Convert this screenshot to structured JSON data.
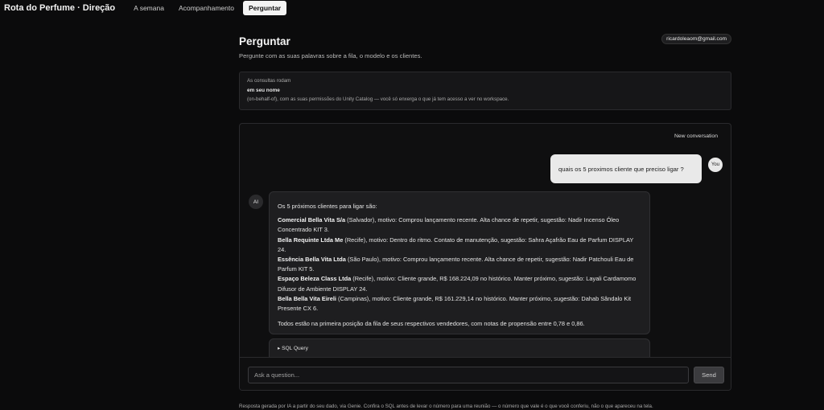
{
  "app": {
    "title": "Rota do Perfume · Direção",
    "nav": [
      {
        "label": "A semana",
        "active": false
      },
      {
        "label": "Acompanhamento",
        "active": false
      },
      {
        "label": "Perguntar",
        "active": true
      }
    ]
  },
  "header": {
    "title": "Perguntar",
    "subtitle": "Pergunte com as suas palavras sobre a fila, o modelo e os clientes.",
    "user_email": "ricardoleaom@gmail.com"
  },
  "notice": {
    "line1": "As consultas rodam",
    "line2": "em seu nome",
    "line3": "(on-behalf-of), com as suas permissões do Unity Catalog — você só enxerga o que já tem acesso a ver no workspace."
  },
  "chat": {
    "new_conversation_label": "New conversation",
    "user_avatar_label": "You",
    "ai_avatar_label": "AI",
    "user_message": "quais os 5 proximos cliente que preciso ligar ?",
    "ai_intro": "Os 5 próximos clientes para ligar são:",
    "clients": [
      {
        "name": "Comercial Bella Vita S/a",
        "rest": " (Salvador), motivo: Comprou lançamento recente. Alta chance de repetir, sugestão: Nadir Incenso Óleo Concentrado KIT 3."
      },
      {
        "name": "Bella Requinte Ltda Me",
        "rest": " (Recife), motivo: Dentro do ritmo. Contato de manutenção, sugestão: Sahra Açafrão Eau de Parfum DISPLAY 24."
      },
      {
        "name": "Essência Bella Vita Ltda",
        "rest": " (São Paulo), motivo: Comprou lançamento recente. Alta chance de repetir, sugestão: Nadir Patchouli Eau de Parfum KIT 5."
      },
      {
        "name": "Espaço Beleza Class Ltda",
        "rest": " (Recife), motivo: Cliente grande, R$ 168.224,09 no histórico. Manter próximo, sugestão: Layali Cardamomo Difusor de Ambiente DISPLAY 24."
      },
      {
        "name": "Bella Bella Vita Eireli",
        "rest": " (Campinas), motivo: Cliente grande, R$ 161.229,14 no histórico. Manter próximo, sugestão: Dahab Sândalo Kit Presente CX 6."
      }
    ],
    "ai_outro": "Todos estão na primeira posição da fila de seus respectivos vendedores, com notas de propensão entre 0,78 e 0,86.",
    "sql_toggle_label": "▸ SQL Query",
    "input_placeholder": "Ask a question...",
    "send_label": "Send"
  },
  "footer": {
    "text": "Resposta gerada por IA a partir do seu dado, via Genie. Confira o SQL antes de levar o número para uma reunião — o número que vale é o que você conferiu, não o que apareceu na tela."
  }
}
